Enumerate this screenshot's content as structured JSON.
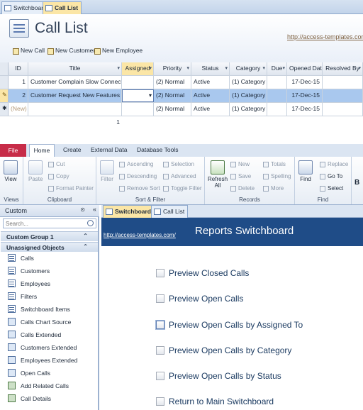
{
  "calllist": {
    "doc_tabs": [
      "Switchboard",
      "Call List"
    ],
    "form_title": "Call List",
    "link": "http://access-templates.com/",
    "toolbar": [
      "New Call",
      "New Customer",
      "New Employee"
    ],
    "columns": [
      "ID",
      "Title",
      "Assigned",
      "Priority",
      "Status",
      "Category",
      "Due",
      "Opened Dat",
      "Resolved By"
    ],
    "rows": [
      {
        "id": "1",
        "title": "Customer Complain Slow Connection",
        "assigned": "",
        "priority": "(2) Normal",
        "status": "Active",
        "category": "(1) Category",
        "due": "",
        "opened": "17-Dec-15",
        "resolved": ""
      },
      {
        "id": "2",
        "title": "Customer Request New Features",
        "assigned": "",
        "priority": "(2) Normal",
        "status": "Active",
        "category": "(1) Category",
        "due": "",
        "opened": "17-Dec-15",
        "resolved": ""
      },
      {
        "id": "(New)",
        "title": "",
        "assigned": "",
        "priority": "(2) Normal",
        "status": "Active",
        "category": "(1) Category",
        "due": "",
        "opened": "17-Dec-15",
        "resolved": ""
      }
    ],
    "total": "1"
  },
  "ribbon": {
    "file": "File",
    "tabs": [
      "Home",
      "Create",
      "External Data",
      "Database Tools"
    ],
    "views": {
      "view": "View",
      "label": "Views"
    },
    "clipboard": {
      "paste": "Paste",
      "cut": "Cut",
      "copy": "Copy",
      "format_painter": "Format Painter",
      "label": "Clipboard"
    },
    "sort": {
      "filter": "Filter",
      "ascending": "Ascending",
      "descending": "Descending",
      "remove_sort": "Remove Sort",
      "selection": "Selection",
      "advanced": "Advanced",
      "toggle_filter": "Toggle Filter",
      "label": "Sort & Filter"
    },
    "records": {
      "refresh": "Refresh",
      "refresh_sub": "All",
      "new": "New",
      "save": "Save",
      "delete": "Delete",
      "totals": "Totals",
      "spelling": "Spelling",
      "more": "More",
      "label": "Records"
    },
    "find": {
      "find": "Find",
      "replace": "Replace",
      "goto": "Go To",
      "select": "Select",
      "label": "Find"
    },
    "bold": "B"
  },
  "nav": {
    "header": "Custom",
    "search_placeholder": "Search...",
    "group1": "Custom Group 1",
    "group2": "Unassigned Objects",
    "items": [
      "Calls",
      "Customers",
      "Employees",
      "Filters",
      "Switchboard Items",
      "Calls Chart Source",
      "Calls Extended",
      "Customers Extended",
      "Employees Extended",
      "Open Calls",
      "Add Related Calls",
      "Call Details"
    ]
  },
  "switchboard": {
    "tabs": [
      "Switchboard",
      "Call List"
    ],
    "link": "http://access-templates.com/",
    "title": "Reports Switchboard",
    "items": [
      "Preview Closed Calls",
      "Preview Open Calls",
      "Preview Open Calls by Assigned To",
      "Preview Open Calls by Category",
      "Preview Open Calls by Status",
      "Return to Main Switchboard"
    ]
  }
}
